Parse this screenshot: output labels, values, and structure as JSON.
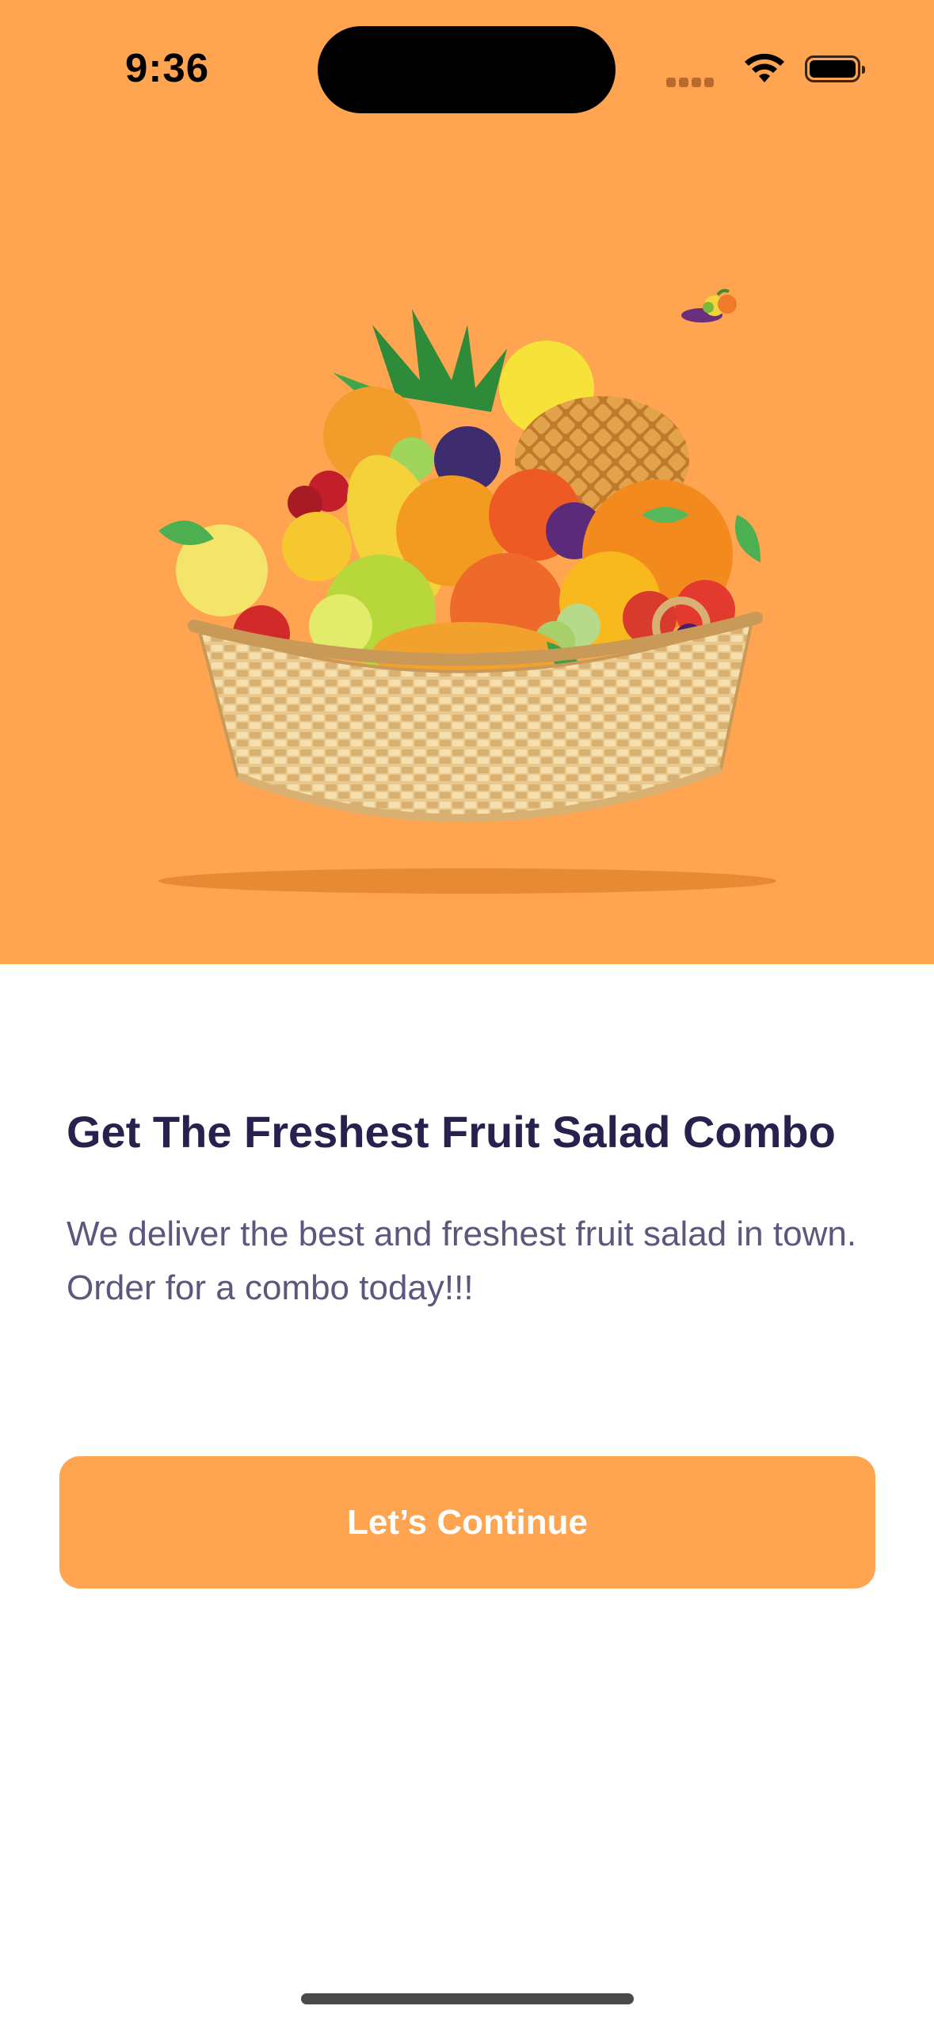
{
  "status_bar": {
    "time": "9:36"
  },
  "hero": {
    "image": "fruit-basket-illustration",
    "accent": "#FFA451"
  },
  "content": {
    "title": "Get The Freshest Fruit Salad Combo",
    "description_line1": "We deliver the best and freshest fruit salad in town.",
    "description_line2": "Order for a combo today!!!"
  },
  "actions": {
    "continue_label": "Let’s Continue"
  },
  "colors": {
    "primary": "#FFA451",
    "title_text": "#27214D",
    "body_text": "#5D577E",
    "background": "#FFFFFF"
  }
}
